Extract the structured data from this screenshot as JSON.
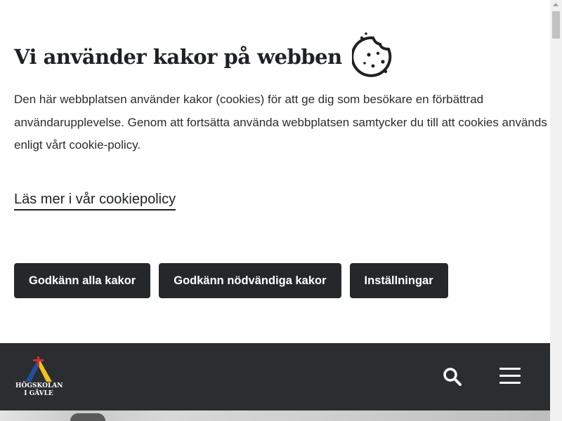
{
  "cookie_banner": {
    "title": "Vi använder kakor på webben",
    "icon": "cookie-icon",
    "description": "Den här webbplatsen använder kakor (cookies) för att ge dig som besökare en förbättrad användarupplevelse. Genom att fortsätta använda webbplatsen samtycker du till att cookies används enligt vårt cookie-policy.",
    "policy_link": "Läs mer i vår cookiepolicy",
    "buttons": {
      "accept_all": "Godkänn alla kakor",
      "accept_necessary": "Godkänn nödvändiga kakor",
      "settings": "Inställningar"
    }
  },
  "header": {
    "logo_line1": "HÖGSKOLAN",
    "logo_line2": "I GÄVLE",
    "search_icon": "search-icon",
    "menu_icon": "hamburger-menu-icon"
  },
  "colors": {
    "button_bg": "#25282b",
    "header_bg": "#2b2d30",
    "logo_blue": "#1f4fa0",
    "logo_yellow": "#f2c21b",
    "logo_red": "#d32f2f"
  }
}
